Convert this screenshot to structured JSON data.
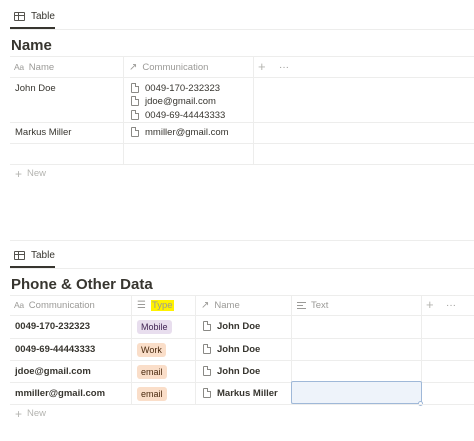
{
  "table1": {
    "view_tab": "Table",
    "title": "Name",
    "columns": [
      {
        "icon": "text-property-icon",
        "icon_glyph": "Aa",
        "label": "Name"
      },
      {
        "icon": "relation-arrow-icon",
        "icon_glyph": "↗",
        "label": "Communication"
      }
    ],
    "rows": [
      {
        "name": "John Doe",
        "communication": [
          "0049-170-232323",
          "jdoe@gmail.com",
          "0049-69-44443333"
        ]
      },
      {
        "name": "Markus Miller",
        "communication": [
          "mmiller@gmail.com"
        ]
      }
    ],
    "new_label": "New"
  },
  "table2": {
    "view_tab": "Table",
    "title": "Phone & Other Data",
    "columns": [
      {
        "icon": "text-property-icon",
        "icon_glyph": "Aa",
        "label": "Communication"
      },
      {
        "icon": "select-list-icon",
        "label": "Type"
      },
      {
        "icon": "relation-arrow-icon",
        "icon_glyph": "↗",
        "label": "Name"
      },
      {
        "icon": "text-lines-icon",
        "label": "Text"
      }
    ],
    "rows": [
      {
        "communication": "0049-170-232323",
        "type": "Mobile",
        "type_bg": "#e8deee",
        "type_fg": "#412454",
        "name": "John Doe"
      },
      {
        "communication": "0049-69-44443333",
        "type": "Work",
        "type_bg": "#fadec9",
        "type_fg": "#49290e",
        "name": "John Doe"
      },
      {
        "communication": "jdoe@gmail.com",
        "type": "email",
        "type_bg": "#fadec9",
        "type_fg": "#49290e",
        "name": "John Doe"
      },
      {
        "communication": "mmiller@gmail.com",
        "type": "email",
        "type_bg": "#fadec9",
        "type_fg": "#49290e",
        "name": "Markus Miller"
      }
    ],
    "new_label": "New"
  },
  "colors": {
    "highlight": "#fff200",
    "selected_cell_border": "#9fb8d8",
    "selected_cell_bg": "#eef3fa"
  }
}
